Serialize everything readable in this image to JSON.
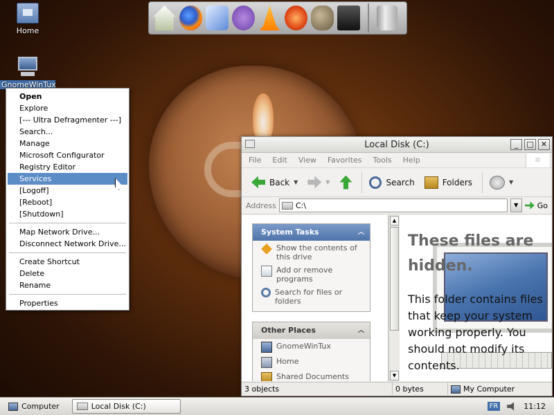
{
  "desktop": {
    "icons": [
      {
        "label": "Home",
        "icon": "home-folder-icon"
      },
      {
        "label": "GnomeWinTux",
        "icon": "computer-icon"
      }
    ]
  },
  "dock": {
    "items": [
      "home-icon",
      "firefox-icon",
      "mail-icon",
      "pidgin-icon",
      "vlc-icon",
      "ubuntu-icon",
      "gimp-icon",
      "inkscape-icon",
      "trash-icon"
    ]
  },
  "context_menu": {
    "groups": [
      [
        "Open",
        "Explore",
        "[--- Ultra Defragmenter ---]",
        "Search...",
        "Manage",
        "Microsoft Configurator",
        "Registry Editor",
        "Services",
        "[Logoff]",
        "[Reboot]",
        "[Shutdown]"
      ],
      [
        "Map Network Drive...",
        "Disconnect Network Drive..."
      ],
      [
        "Create Shortcut",
        "Delete",
        "Rename"
      ],
      [
        "Properties"
      ]
    ],
    "highlighted": "Services"
  },
  "window": {
    "title": "Local Disk (C:)",
    "controls": {
      "minimize": "_",
      "maximize": "□",
      "close": "✕"
    },
    "menu": [
      "File",
      "Edit",
      "View",
      "Favorites",
      "Tools",
      "Help"
    ],
    "toolbar": {
      "back": "Back",
      "search": "Search",
      "folders": "Folders"
    },
    "address": {
      "label": "Address",
      "value": "C:\\",
      "go": "Go"
    },
    "system_tasks": {
      "title": "System Tasks",
      "items": [
        "Show the contents of this drive",
        "Add or remove programs",
        "Search for files or folders"
      ]
    },
    "other_places": {
      "title": "Other Places",
      "items": [
        "GnomeWinTux",
        "Home",
        "Shared Documents"
      ]
    },
    "hidden_title": "These files are hidden.",
    "hidden_text": "This folder contains files that keep your system working properly. You should not modify its contents.",
    "status": {
      "objects": "3 objects",
      "size": "0 bytes",
      "location": "My Computer"
    }
  },
  "taskbar": {
    "computer": "Computer",
    "active": "Local Disk (C:)",
    "lang": "FR",
    "time": "11:12"
  },
  "colors": {
    "menu_highlight": "#5c8cc6",
    "task_header": "#4f74aa",
    "accent_green": "#3aa838"
  }
}
